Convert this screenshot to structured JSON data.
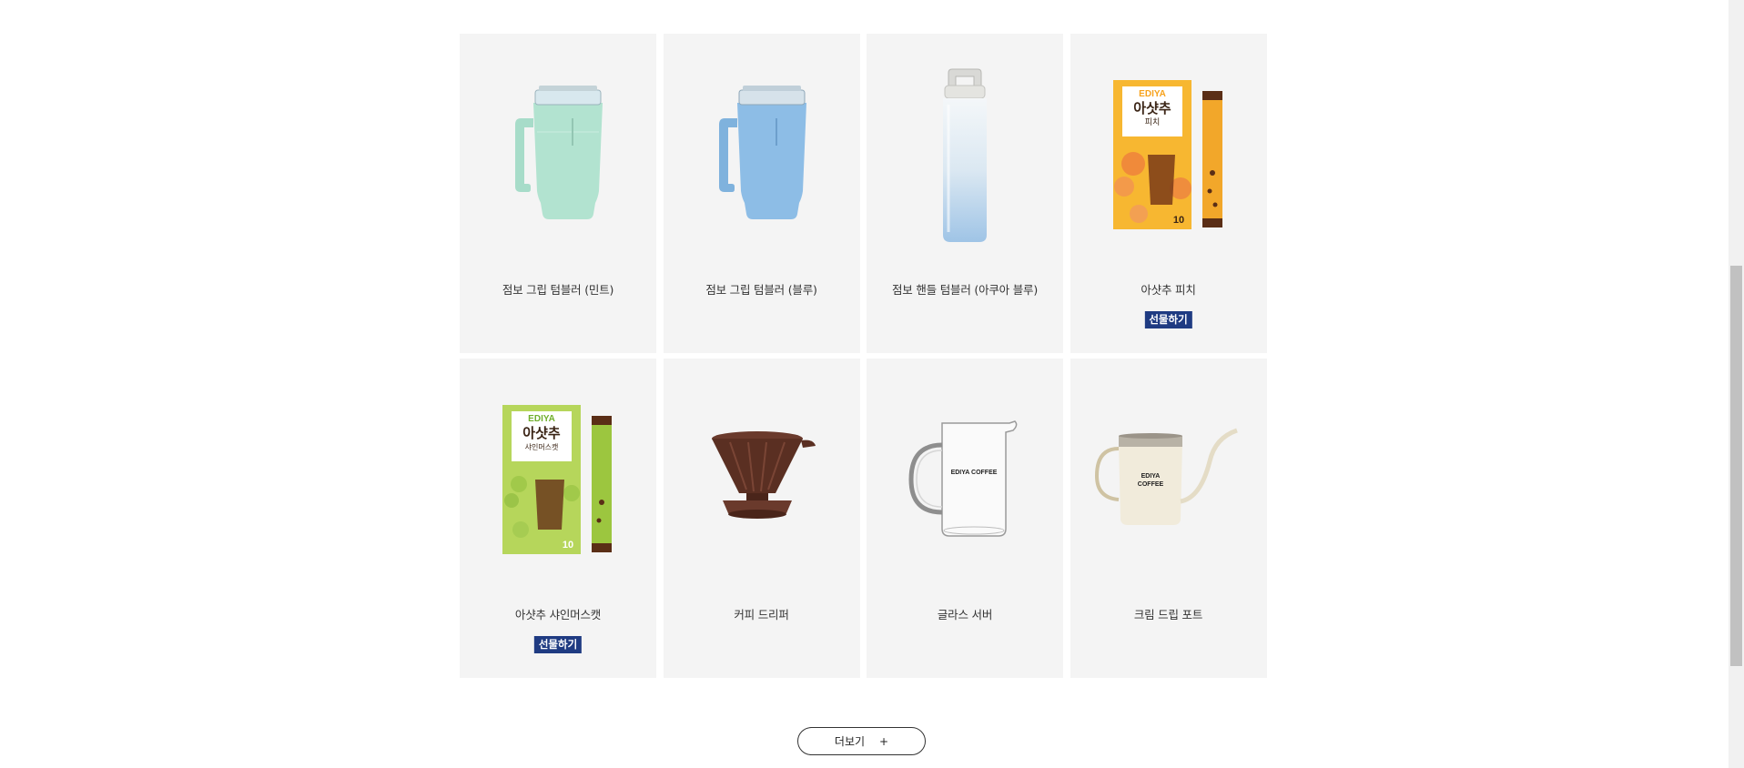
{
  "products": [
    {
      "name": "점보 그립 텀블러 (민트)",
      "icon": "mint-grip-tumbler-image",
      "gift": null
    },
    {
      "name": "점보 그립 텀블러 (블루)",
      "icon": "blue-grip-tumbler-image",
      "gift": null
    },
    {
      "name": "점보 핸들 텀블러 (아쿠아 블루)",
      "icon": "aqua-handle-tumbler-image",
      "gift": null
    },
    {
      "name": "아샷추 피치",
      "icon": "ashotchu-peach-box-image",
      "gift": "선물하기",
      "box_texts": {
        "brand": "EDIYA",
        "title": "아샷추",
        "flavor": "피치",
        "count": "10"
      }
    },
    {
      "name": "아샷추 샤인머스캣",
      "icon": "ashotchu-shinemuscat-box-image",
      "gift": "선물하기",
      "box_texts": {
        "brand": "EDIYA",
        "title": "아샷추",
        "flavor": "샤인머스캣",
        "count": "10"
      }
    },
    {
      "name": "커피 드리퍼",
      "icon": "coffee-dripper-image",
      "gift": null
    },
    {
      "name": "글라스 서버",
      "icon": "glass-server-image",
      "gift": null,
      "print": "EDIYA COFFEE"
    },
    {
      "name": "크림 드립 포트",
      "icon": "cream-drip-pot-image",
      "gift": null,
      "print": [
        "EDIYA",
        "COFFEE"
      ]
    }
  ],
  "more_button": {
    "label": "더보기",
    "icon": "+"
  },
  "colors": {
    "card_bg": "#f4f4f4",
    "gift_bg": "#1f3b82"
  }
}
